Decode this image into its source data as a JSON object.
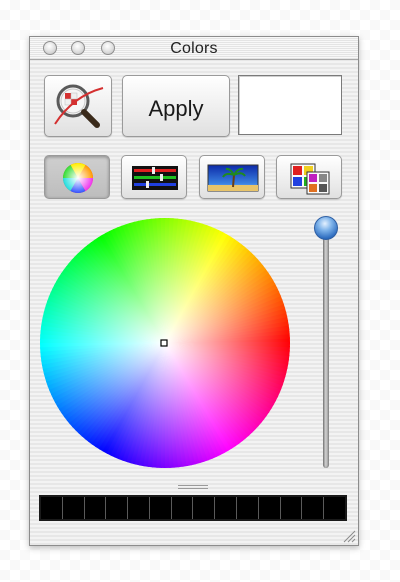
{
  "window": {
    "title": "Colors"
  },
  "toolbar": {
    "apply_label": "Apply",
    "magnifier_icon": "magnifier-icon",
    "color_swatch_color": "#ffffff"
  },
  "modes": [
    {
      "icon": "color-wheel-mode-icon",
      "active": true
    },
    {
      "icon": "sliders-mode-icon",
      "active": false
    },
    {
      "icon": "image-palette-mode-icon",
      "active": false
    },
    {
      "icon": "crayon-palette-mode-icon",
      "active": false
    }
  ],
  "wheel": {
    "brightness": 1.0,
    "selected_color": "#ffffff"
  },
  "swatches": {
    "count": 14,
    "color": "#000000"
  }
}
